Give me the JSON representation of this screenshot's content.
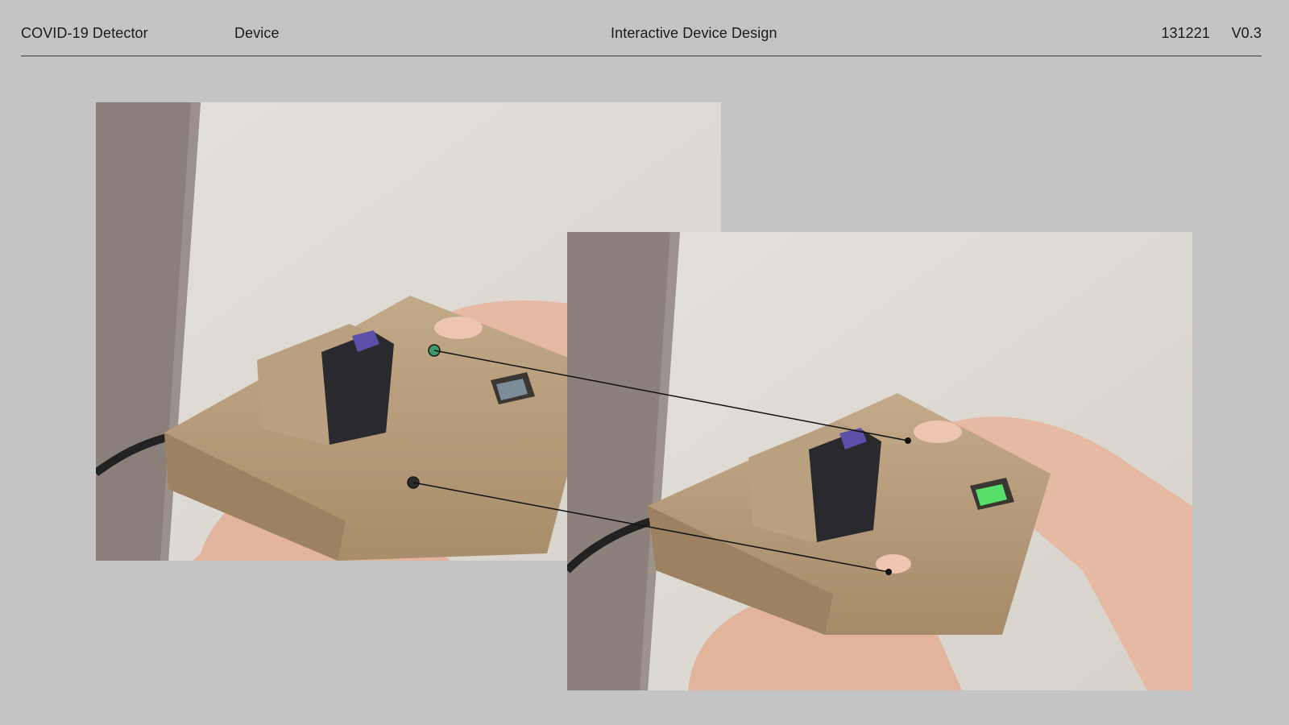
{
  "header": {
    "project_title": "COVID-19 Detector",
    "section": "Device",
    "course": "Interactive Device Design",
    "date": "131221",
    "version": "V0.3"
  },
  "photos": [
    {
      "subject": "cardboard device held in hands, LED off",
      "marker_colors": [
        "#3e9a6a",
        "#2a2a2a"
      ]
    },
    {
      "subject": "cardboard device held in hands, display lit",
      "display_color": "#56e06a"
    }
  ],
  "colors": {
    "background": "#c4c4c4",
    "text": "#1a1a1a",
    "rule": "#3a3a3a",
    "cardboard": "#b49a78",
    "wall": "#e2dfda",
    "door_frame": "#8a8079"
  }
}
